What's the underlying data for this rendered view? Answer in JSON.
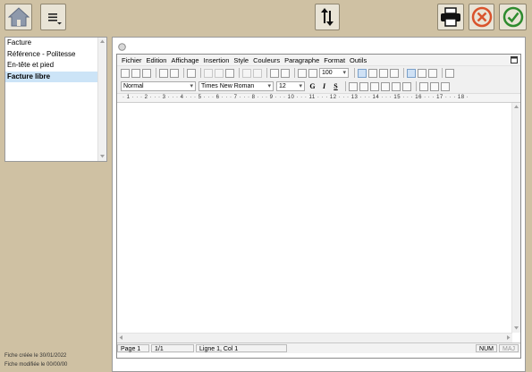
{
  "toolbar": {
    "home_icon": "home-icon",
    "menu_icon": "hamburger-menu-icon",
    "sort_icon": "sort-arrows-icon",
    "print_icon": "printer-icon",
    "cancel_icon": "cancel-circle-icon",
    "confirm_icon": "confirm-check-icon"
  },
  "left_list": {
    "items": [
      "Facture",
      "Référence - Politesse",
      "En-tête et pied",
      "Facture libre"
    ],
    "selected_index": 3
  },
  "footer": {
    "created": "Fiche créée le 30/01/2022",
    "modified": "Fiche modifiée le 00/00/00"
  },
  "editor": {
    "menu": [
      "Fichier",
      "Edition",
      "Affichage",
      "Insertion",
      "Style",
      "Couleurs",
      "Paragraphe",
      "Format",
      "Outils"
    ],
    "zoom": "100",
    "style_value": "Normal",
    "font_value": "Times New Roman",
    "size_value": "12",
    "bold_label": "G",
    "italic_label": "I",
    "underline_label": "S",
    "ruler_text": "· 1 · · · 2 · · · 3 · · · 4 · · · 5 · · · 6 · · · 7 · · · 8 · · · 9 · · · 10 · · · 11 · · · 12 · · · 13 · · · 14 · · · 15 · · · 16 · · · 17 · · · 18 ·",
    "status": {
      "page": "Page 1",
      "pages": "1/1",
      "position": "Ligne 1, Col 1",
      "num": "NUM",
      "maj": "MAJ"
    }
  },
  "colors": {
    "background": "#cfc1a3",
    "selection": "#cce4f7",
    "cancel": "#d9532c",
    "confirm": "#2e8b2e"
  }
}
